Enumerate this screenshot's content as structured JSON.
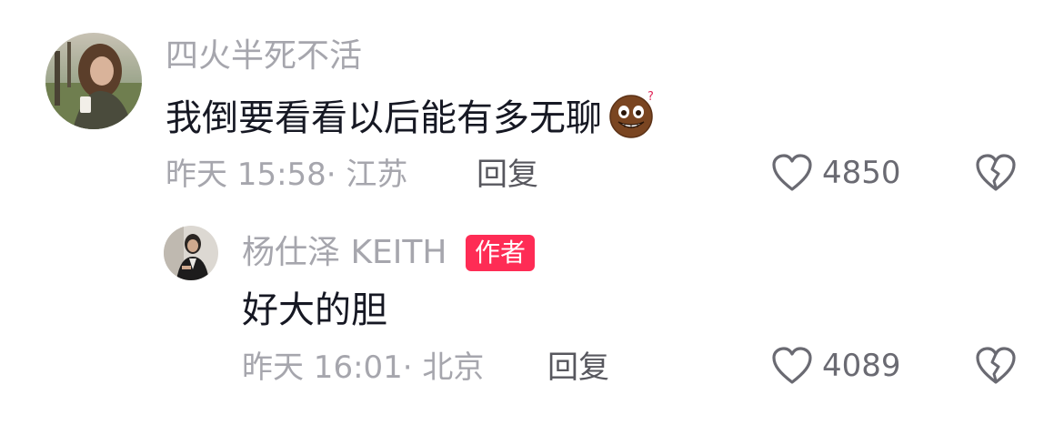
{
  "comments": [
    {
      "username": "四火半死不活",
      "text": "我倒要看看以后能有多无聊",
      "emoji": "nervous-grin-emoji",
      "meta": "昨天 15:58· 江苏",
      "reply_label": "回复",
      "likes": "4850"
    }
  ],
  "replies": [
    {
      "username": "杨仕泽 KEITH",
      "badge": "作者",
      "text": "好大的胆",
      "meta": "昨天 16:01· 北京",
      "reply_label": "回复",
      "likes": "4089"
    }
  ],
  "colors": {
    "username": "#a6a6ad",
    "text": "#161823",
    "badge_bg": "#fe2c55",
    "icon": "#6a6a72"
  }
}
